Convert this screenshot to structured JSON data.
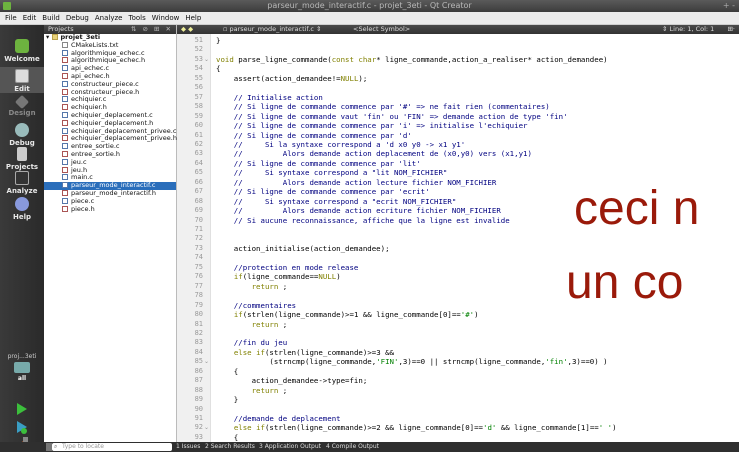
{
  "window": {
    "title": "parseur_mode_interactif.c - projet_3eti - Qt Creator",
    "controls": "+ -"
  },
  "menu": [
    "File",
    "Edit",
    "Build",
    "Debug",
    "Analyze",
    "Tools",
    "Window",
    "Help"
  ],
  "modes": [
    {
      "label": "Welcome",
      "icon": "welcome-icon"
    },
    {
      "label": "Edit",
      "icon": "edit-icon"
    },
    {
      "label": "Design",
      "icon": "design-icon"
    },
    {
      "label": "Debug",
      "icon": "debug-icon"
    },
    {
      "label": "Projects",
      "icon": "projects-icon"
    },
    {
      "label": "Analyze",
      "icon": "analyze-icon"
    },
    {
      "label": "Help",
      "icon": "help-icon"
    }
  ],
  "kit": {
    "project": "proj...3eti",
    "config": "all"
  },
  "sidebar": {
    "title": "Projects",
    "project": "projet_3eti",
    "files": [
      {
        "name": "CMakeLists.txt",
        "type": "txt"
      },
      {
        "name": "algorithmique_echec.c",
        "type": "c"
      },
      {
        "name": "algorithmique_echec.h",
        "type": "h"
      },
      {
        "name": "api_echec.c",
        "type": "c"
      },
      {
        "name": "api_echec.h",
        "type": "h"
      },
      {
        "name": "constructeur_piece.c",
        "type": "c"
      },
      {
        "name": "constructeur_piece.h",
        "type": "h"
      },
      {
        "name": "echiquier.c",
        "type": "c"
      },
      {
        "name": "echiquier.h",
        "type": "h"
      },
      {
        "name": "echiquier_deplacement.c",
        "type": "c"
      },
      {
        "name": "echiquier_deplacement.h",
        "type": "h"
      },
      {
        "name": "echiquier_deplacement_privee.c",
        "type": "c"
      },
      {
        "name": "echiquier_deplacement_privee.h",
        "type": "h"
      },
      {
        "name": "entree_sortie.c",
        "type": "c"
      },
      {
        "name": "entree_sortie.h",
        "type": "h"
      },
      {
        "name": "jeu.c",
        "type": "c"
      },
      {
        "name": "jeu.h",
        "type": "h"
      },
      {
        "name": "main.c",
        "type": "c"
      },
      {
        "name": "parseur_mode_interactif.c",
        "type": "c",
        "selected": true
      },
      {
        "name": "parseur_mode_interactif.h",
        "type": "h"
      },
      {
        "name": "piece.c",
        "type": "c"
      },
      {
        "name": "piece.h",
        "type": "h"
      }
    ]
  },
  "editor": {
    "file": "parseur_mode_interactif.c",
    "symbol": "<Select Symbol>",
    "position": "Line: 1, Col: 1",
    "first_line": 51,
    "lines": [
      "}",
      "",
      "void parse_ligne_commande(const char* ligne_commande,action_a_realiser* action_demandee)",
      "{",
      "    assert(action_demandee!=NULL);",
      "",
      "    // Initialise action",
      "    // Si ligne de commande commence par '#' => ne fait rien (commentaires)",
      "    // Si ligne de commande vaut 'fin' ou 'FIN' => demande action de type 'fin'",
      "    // Si ligne de commande commence par 'i' => initialise l'echiquier",
      "    // Si ligne de commande commence par 'd'",
      "    //     Si la syntaxe correspond a 'd x0 y0 -> x1 y1'",
      "    //         Alors demande action deplacement de (x0,y0) vers (x1,y1)",
      "    // Si ligne de commande commence par 'lit'",
      "    //     Si syntaxe correspond a \"lit NOM_FICHIER\"",
      "    //         Alors demande action lecture fichier NOM_FICHIER",
      "    // Si ligne de commande commence par 'ecrit'",
      "    //     Si syntaxe correspond a \"ecrit NOM_FICHIER\"",
      "    //         Alors demande action ecriture fichier NOM_FICHIER",
      "    // Si aucune reconnaissance, affiche que la ligne est invalide",
      "",
      "",
      "    action_initialise(action_demandee);",
      "",
      "    //protection en mode release",
      "    if(ligne_commande==NULL)",
      "        return ;",
      "",
      "    //commentaires",
      "    if(strlen(ligne_commande)>=1 && ligne_commande[0]=='#')",
      "        return ;",
      "",
      "    //fin du jeu",
      "    else if(strlen(ligne_commande)>=3 &&",
      "            (strncmp(ligne_commande,'FIN',3)==0 || strncmp(ligne_commande,'fin',3)==0) )",
      "    {",
      "        action_demandee->type=fin;",
      "        return ;",
      "    }",
      "",
      "    //demande de deplacement",
      "    else if(strlen(ligne_commande)>=2 && ligne_commande[0]=='d' && ligne_commande[1]==' ')",
      "    {"
    ]
  },
  "overlay": {
    "line1": "ceci n",
    "line2": "un co"
  },
  "statusbar": {
    "locate_placeholder": "Type to locate",
    "panes": [
      "1 Issues",
      "2 Search Results",
      "3 Application Output",
      "4 Compile Output"
    ]
  }
}
